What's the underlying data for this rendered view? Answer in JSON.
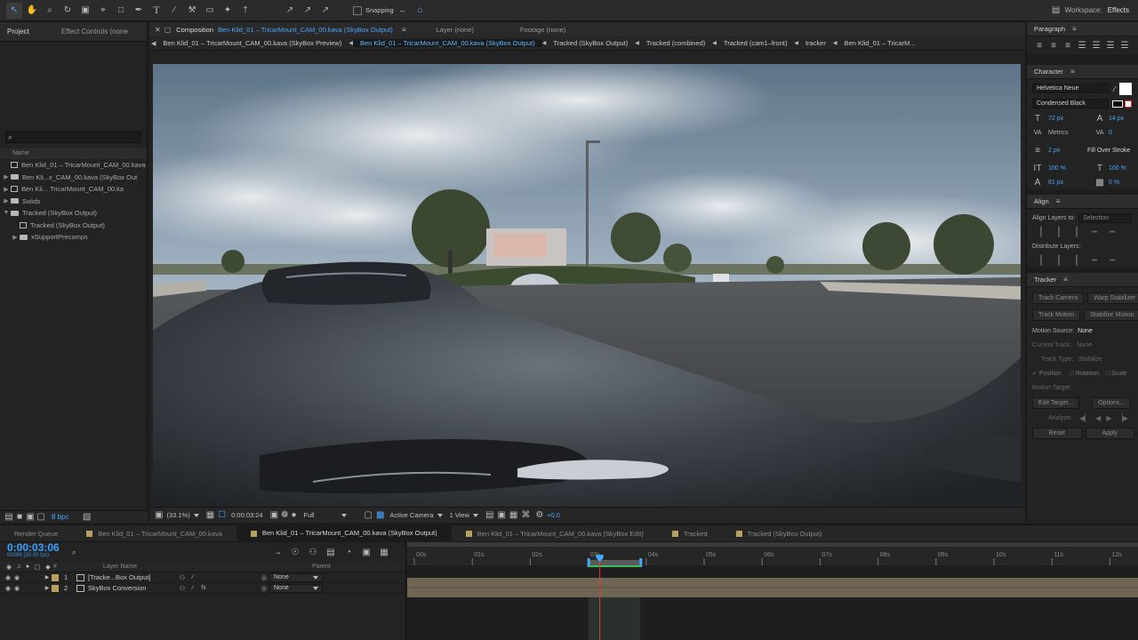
{
  "toolbar": {
    "snapping_label": "Snapping",
    "workspace_label": "Workspace:",
    "workspace_value": "Effects"
  },
  "project": {
    "tab_project": "Project",
    "tab_effect_controls": "Effect Controls (none",
    "list_header": "Name",
    "items": [
      {
        "label": "Ben Klid_01 – TricarMount_CAM_00.kava",
        "type": "comp",
        "twirl": ""
      },
      {
        "label": "Ben Kli...x_CAM_00.kava (SkyBox Out",
        "type": "folder",
        "twirl": "▶"
      },
      {
        "label": "Ben Kli... TricarMount_CAM_00.ka",
        "type": "comp",
        "twirl": "▶"
      },
      {
        "label": "Solids",
        "type": "folder",
        "twirl": "▶"
      },
      {
        "label": "Tracked (SkyBox Output)",
        "type": "folder",
        "twirl": "▼"
      },
      {
        "label": "Tracked (SkyBox Output)",
        "type": "comp",
        "twirl": "",
        "indent": true
      },
      {
        "label": "xSupportPrecomps",
        "type": "folder",
        "twirl": "▶",
        "indent": true
      }
    ],
    "bpc": "8 bpc"
  },
  "viewer": {
    "comp_label": "Composition",
    "comp_name": "Ben Klid_01 – TricarMount_CAM_00.kava (SkyBox Output)",
    "layer_tab": "Layer (none)",
    "footage_tab": "Footage (none)",
    "subtabs": [
      "Ben Klid_01 – TricarMount_CAM_00.kava (SkyBox Preview)",
      "Ben Klid_01 – TricarMount_CAM_00.kava (SkyBox Output)",
      "Tracked (SkyBox Output)",
      "Tracked (combined)",
      "Tracked (cam1–front)",
      "tracker",
      "Ben Klid_01 – TricarM..."
    ],
    "zoom": "(33.1%)",
    "timecode": "0:00:03:24",
    "resolution": "Full",
    "camera": "Active Camera",
    "views": "1 View",
    "exposure": "+0.0"
  },
  "paragraph": {
    "title": "Paragraph"
  },
  "character": {
    "title": "Character",
    "font": "Helvetica Neue",
    "style": "Condensed Black",
    "size": "72 px",
    "leading": "14 px",
    "kerning": "Metrics",
    "tracking": "0",
    "stroke": "2 px",
    "stroke_mode": "Fill Over Stroke",
    "vscale": "100 %",
    "hscale": "100 %",
    "baseline": "81 px",
    "tsume": "0 %"
  },
  "align": {
    "title": "Align",
    "align_to_label": "Align Layers to:",
    "align_to_value": "Selection",
    "distribute_label": "Distribute Layers:"
  },
  "tracker": {
    "title": "Tracker",
    "track_camera": "Track Camera",
    "warp_stabilizer": "Warp Stabilizer",
    "track_motion": "Track Motion",
    "stabilize_motion": "Stabilize Motion",
    "motion_source_label": "Motion Source:",
    "motion_source_value": "None",
    "current_track_label": "Current Track:",
    "current_track_value": "None",
    "track_type_label": "Track Type:",
    "track_type_value": "Stabilize",
    "position": "Position",
    "rotation": "Rotation",
    "scale": "Scale",
    "motion_target_label": "Motion Target:",
    "edit_target": "Edit Target...",
    "options": "Options...",
    "analyze_label": "Analyze:",
    "reset": "Reset",
    "apply": "Apply"
  },
  "timeline": {
    "tabs": [
      {
        "label": "Render Queue",
        "color": ""
      },
      {
        "label": "Ben Klid_01 – TricarMount_CAM_00.kava",
        "color": "#b8a060"
      },
      {
        "label": "Ben Klid_01 – TricarMount_CAM_00.kava (SkyBox Output)",
        "color": "#b8a060",
        "selected": true
      },
      {
        "label": "Ben Klid_01 – TricarMount_CAM_00.kava (SkyBox Edit)",
        "color": "#b8a060"
      },
      {
        "label": "Tracked",
        "color": "#b8a060"
      },
      {
        "label": "Tracked (SkyBox Output)",
        "color": "#b8a060"
      }
    ],
    "current_time": "0:00:03:06",
    "fps_info": "00096 (30.00 fps)",
    "layer_name_header": "Layer Name",
    "parent_header": "Parent",
    "layers": [
      {
        "num": "1",
        "name": "[Tracke...Box Output]",
        "parent": "None"
      },
      {
        "num": "2",
        "name": "SkyBox Conversion",
        "parent": "None"
      }
    ],
    "ruler": [
      "00s",
      "01s",
      "02s",
      "03s",
      "04s",
      "05s",
      "06s",
      "07s",
      "08s",
      "09s",
      "10s",
      "11s",
      "12s"
    ],
    "playhead_seconds": 3.2,
    "work_area": [
      3.0,
      3.9
    ],
    "duration_seconds": 12.3
  },
  "colors": {
    "accent": "#49a6ff",
    "playhead": "#d83a3a",
    "layer_bar": "#6e6552"
  }
}
